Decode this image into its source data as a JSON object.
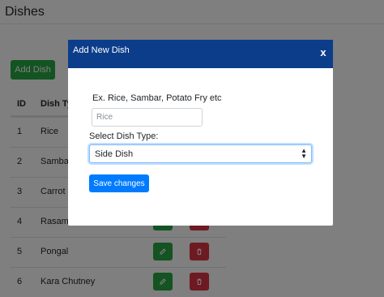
{
  "page": {
    "title": "Dishes",
    "add_button": "Add Dish",
    "table": {
      "headers": [
        "ID",
        "Dish Type"
      ],
      "rows": [
        {
          "id": "1",
          "name": "Rice"
        },
        {
          "id": "2",
          "name": "Sambar"
        },
        {
          "id": "3",
          "name": "Carrot P"
        },
        {
          "id": "4",
          "name": "Rasam"
        },
        {
          "id": "5",
          "name": "Pongal"
        },
        {
          "id": "6",
          "name": "Kara Chutney"
        }
      ]
    }
  },
  "modal": {
    "title": "Add New Dish",
    "close_label": "x",
    "hint": "Ex. Rice, Sambar, Potato Fry etc",
    "name_placeholder": "Rice",
    "select_label": "Select Dish Type:",
    "select_value": "Side Dish",
    "save_label": "Save changes"
  },
  "colors": {
    "header": "#0c3d8a",
    "success": "#28a745",
    "danger": "#dc3545",
    "primary": "#007bff"
  }
}
